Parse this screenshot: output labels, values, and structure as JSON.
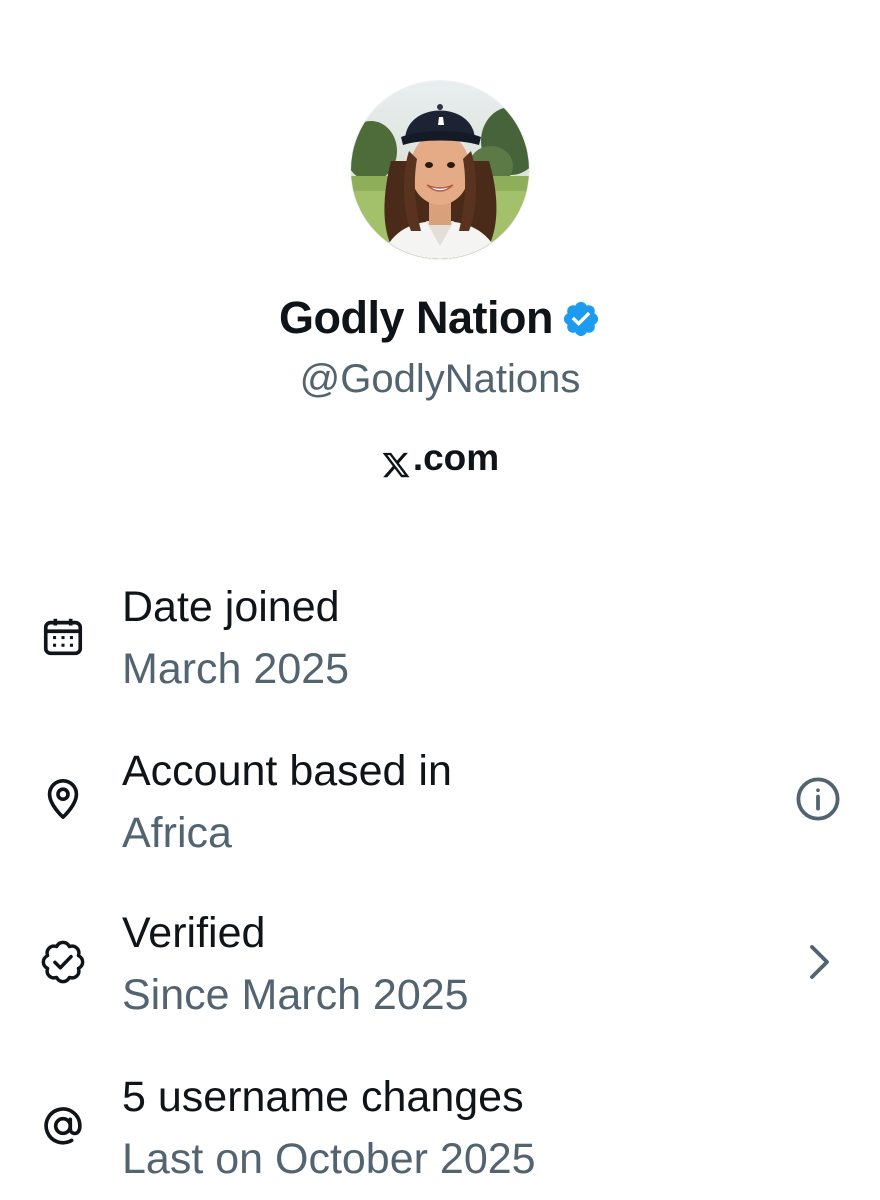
{
  "profile": {
    "display_name": "Godly Nation",
    "handle": "@GodlyNations",
    "source_label": ".com",
    "avatar_icon": "profile-photo",
    "verified_icon": "verified-badge-icon",
    "verified_color": "#1d9bf0"
  },
  "details": [
    {
      "icon": "calendar-icon",
      "title": "Date joined",
      "subtitle": "March 2025"
    },
    {
      "icon": "location-pin-icon",
      "title": "Account based in",
      "subtitle": "Africa",
      "action_icon": "info-icon"
    },
    {
      "icon": "verified-check-icon",
      "title": "Verified",
      "subtitle": "Since March 2025",
      "action_icon": "chevron-right-icon"
    },
    {
      "icon": "at-sign-icon",
      "title": "5 username changes",
      "subtitle": "Last on October 2025"
    }
  ],
  "colors": {
    "primary_text": "#0f1419",
    "secondary_text": "#536471",
    "accent": "#1d9bf0",
    "background": "#ffffff"
  }
}
